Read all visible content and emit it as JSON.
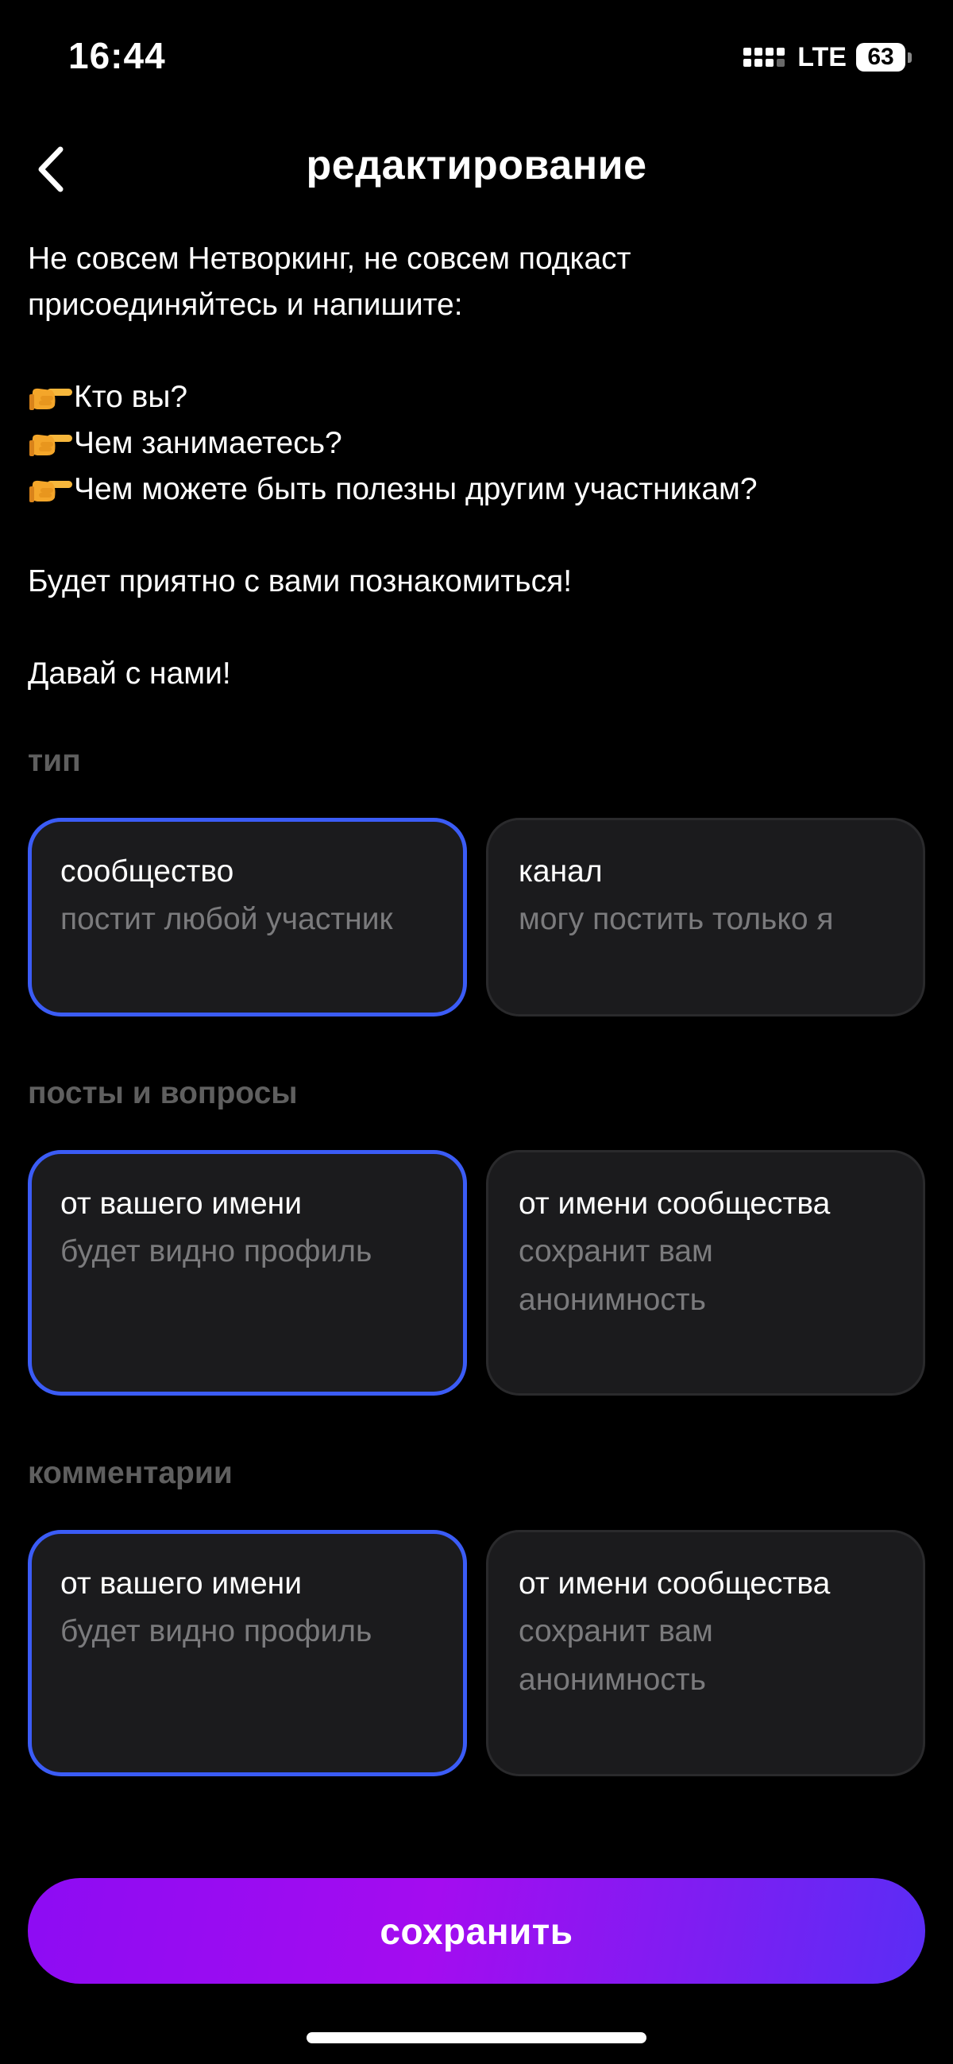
{
  "status_bar": {
    "time": "16:44",
    "network": "LTE",
    "battery": "63"
  },
  "header": {
    "title": "редактирование",
    "back_icon": "chevron-left-icon"
  },
  "description": {
    "lines": [
      "Не совсем Нетворкинг, не совсем подкаст",
      "присоединяйтесь и напишите:",
      "",
      "Кто вы?",
      "Чем занимаетесь?",
      "Чем можете быть полезны другим участникам?",
      "",
      "Будет приятно с вами познакомиться!",
      "",
      "Давай с нами!"
    ],
    "bullet_icon": "pointing-hand-emoji-icon"
  },
  "sections": {
    "type": {
      "label": "тип",
      "options": [
        {
          "title": "сообщество",
          "subtitle": "постит любой участник",
          "selected": true
        },
        {
          "title": "канал",
          "subtitle": "могу постить только я",
          "selected": false
        }
      ]
    },
    "posts": {
      "label": "посты и вопросы",
      "options": [
        {
          "title": "от вашего имени",
          "subtitle": "будет видно профиль",
          "selected": true
        },
        {
          "title": "от имени сообщества",
          "subtitle": "сохранит вам анонимность",
          "selected": false
        }
      ]
    },
    "comments": {
      "label": "комментарии",
      "options": [
        {
          "title": "от вашего имени",
          "subtitle": "будет видно профиль",
          "selected": true
        },
        {
          "title": "от имени сообщества",
          "subtitle": "сохранит вам анонимность",
          "selected": false
        }
      ]
    }
  },
  "save_button": {
    "label": "сохранить"
  },
  "colors": {
    "background": "#000000",
    "card_background": "#1b1b1d",
    "selected_border": "#3b5cf6",
    "section_label": "#5f5f5f",
    "subtitle": "#7b7b7d",
    "button_gradient_start": "#8d0cf3",
    "button_gradient_end": "#5a2df5"
  }
}
